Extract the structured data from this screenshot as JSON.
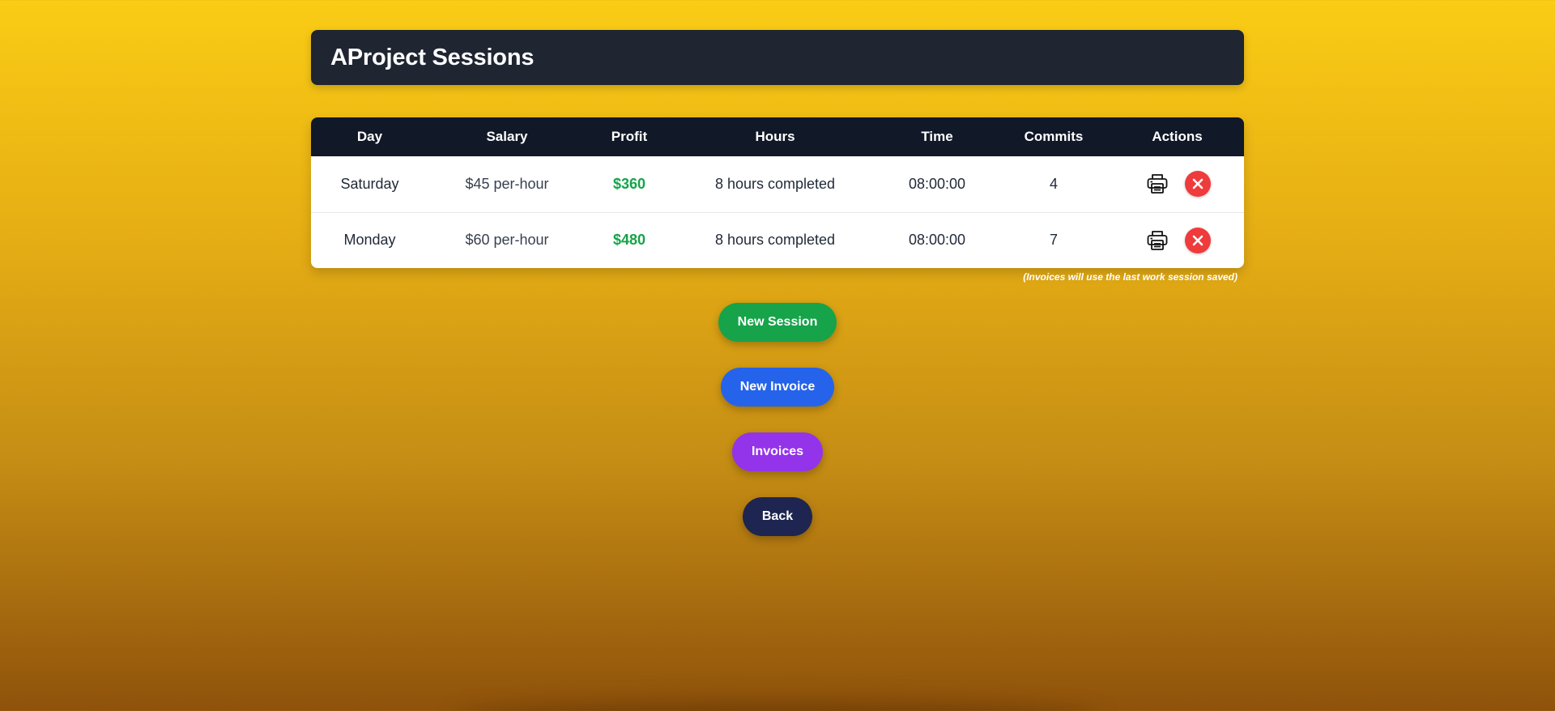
{
  "page": {
    "title": "AProject Sessions"
  },
  "table": {
    "headers": [
      "Day",
      "Salary",
      "Profit",
      "Hours",
      "Time",
      "Commits",
      "Actions"
    ],
    "rows": [
      {
        "day": "Saturday",
        "salary": "$45 per-hour",
        "profit": "$360",
        "hours": "8 hours completed",
        "time": "08:00:00",
        "commits": "4"
      },
      {
        "day": "Monday",
        "salary": "$60 per-hour",
        "profit": "$480",
        "hours": "8 hours completed",
        "time": "08:00:00",
        "commits": "7"
      }
    ],
    "note": "(Invoices will use the last work session saved)"
  },
  "buttons": {
    "new_session": "New Session",
    "new_invoice": "New Invoice",
    "invoices": "Invoices",
    "back": "Back"
  },
  "icons": {
    "print": "printer-icon",
    "delete": "close-icon"
  },
  "colors": {
    "profit": "#16a34a",
    "new_session": "#16a34a",
    "new_invoice": "#2563eb",
    "invoices": "#9333ea",
    "back": "#1e2550",
    "delete": "#ef3b3b",
    "header": "#111827"
  }
}
